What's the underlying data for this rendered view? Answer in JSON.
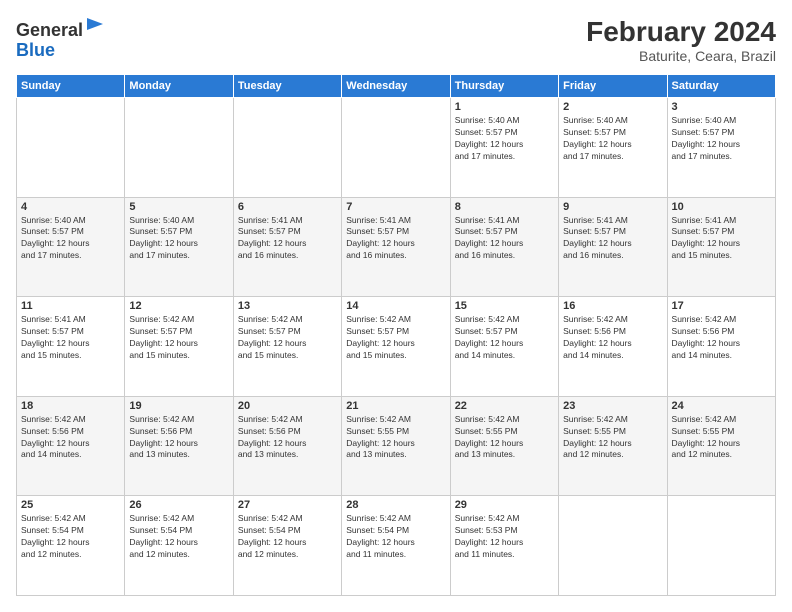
{
  "logo": {
    "general": "General",
    "blue": "Blue"
  },
  "header": {
    "month_title": "February 2024",
    "location": "Baturite, Ceara, Brazil"
  },
  "weekdays": [
    "Sunday",
    "Monday",
    "Tuesday",
    "Wednesday",
    "Thursday",
    "Friday",
    "Saturday"
  ],
  "weeks": [
    [
      {
        "day": "",
        "info": ""
      },
      {
        "day": "",
        "info": ""
      },
      {
        "day": "",
        "info": ""
      },
      {
        "day": "",
        "info": ""
      },
      {
        "day": "1",
        "info": "Sunrise: 5:40 AM\nSunset: 5:57 PM\nDaylight: 12 hours\nand 17 minutes."
      },
      {
        "day": "2",
        "info": "Sunrise: 5:40 AM\nSunset: 5:57 PM\nDaylight: 12 hours\nand 17 minutes."
      },
      {
        "day": "3",
        "info": "Sunrise: 5:40 AM\nSunset: 5:57 PM\nDaylight: 12 hours\nand 17 minutes."
      }
    ],
    [
      {
        "day": "4",
        "info": "Sunrise: 5:40 AM\nSunset: 5:57 PM\nDaylight: 12 hours\nand 17 minutes."
      },
      {
        "day": "5",
        "info": "Sunrise: 5:40 AM\nSunset: 5:57 PM\nDaylight: 12 hours\nand 17 minutes."
      },
      {
        "day": "6",
        "info": "Sunrise: 5:41 AM\nSunset: 5:57 PM\nDaylight: 12 hours\nand 16 minutes."
      },
      {
        "day": "7",
        "info": "Sunrise: 5:41 AM\nSunset: 5:57 PM\nDaylight: 12 hours\nand 16 minutes."
      },
      {
        "day": "8",
        "info": "Sunrise: 5:41 AM\nSunset: 5:57 PM\nDaylight: 12 hours\nand 16 minutes."
      },
      {
        "day": "9",
        "info": "Sunrise: 5:41 AM\nSunset: 5:57 PM\nDaylight: 12 hours\nand 16 minutes."
      },
      {
        "day": "10",
        "info": "Sunrise: 5:41 AM\nSunset: 5:57 PM\nDaylight: 12 hours\nand 15 minutes."
      }
    ],
    [
      {
        "day": "11",
        "info": "Sunrise: 5:41 AM\nSunset: 5:57 PM\nDaylight: 12 hours\nand 15 minutes."
      },
      {
        "day": "12",
        "info": "Sunrise: 5:42 AM\nSunset: 5:57 PM\nDaylight: 12 hours\nand 15 minutes."
      },
      {
        "day": "13",
        "info": "Sunrise: 5:42 AM\nSunset: 5:57 PM\nDaylight: 12 hours\nand 15 minutes."
      },
      {
        "day": "14",
        "info": "Sunrise: 5:42 AM\nSunset: 5:57 PM\nDaylight: 12 hours\nand 15 minutes."
      },
      {
        "day": "15",
        "info": "Sunrise: 5:42 AM\nSunset: 5:57 PM\nDaylight: 12 hours\nand 14 minutes."
      },
      {
        "day": "16",
        "info": "Sunrise: 5:42 AM\nSunset: 5:56 PM\nDaylight: 12 hours\nand 14 minutes."
      },
      {
        "day": "17",
        "info": "Sunrise: 5:42 AM\nSunset: 5:56 PM\nDaylight: 12 hours\nand 14 minutes."
      }
    ],
    [
      {
        "day": "18",
        "info": "Sunrise: 5:42 AM\nSunset: 5:56 PM\nDaylight: 12 hours\nand 14 minutes."
      },
      {
        "day": "19",
        "info": "Sunrise: 5:42 AM\nSunset: 5:56 PM\nDaylight: 12 hours\nand 13 minutes."
      },
      {
        "day": "20",
        "info": "Sunrise: 5:42 AM\nSunset: 5:56 PM\nDaylight: 12 hours\nand 13 minutes."
      },
      {
        "day": "21",
        "info": "Sunrise: 5:42 AM\nSunset: 5:55 PM\nDaylight: 12 hours\nand 13 minutes."
      },
      {
        "day": "22",
        "info": "Sunrise: 5:42 AM\nSunset: 5:55 PM\nDaylight: 12 hours\nand 13 minutes."
      },
      {
        "day": "23",
        "info": "Sunrise: 5:42 AM\nSunset: 5:55 PM\nDaylight: 12 hours\nand 12 minutes."
      },
      {
        "day": "24",
        "info": "Sunrise: 5:42 AM\nSunset: 5:55 PM\nDaylight: 12 hours\nand 12 minutes."
      }
    ],
    [
      {
        "day": "25",
        "info": "Sunrise: 5:42 AM\nSunset: 5:54 PM\nDaylight: 12 hours\nand 12 minutes."
      },
      {
        "day": "26",
        "info": "Sunrise: 5:42 AM\nSunset: 5:54 PM\nDaylight: 12 hours\nand 12 minutes."
      },
      {
        "day": "27",
        "info": "Sunrise: 5:42 AM\nSunset: 5:54 PM\nDaylight: 12 hours\nand 12 minutes."
      },
      {
        "day": "28",
        "info": "Sunrise: 5:42 AM\nSunset: 5:54 PM\nDaylight: 12 hours\nand 11 minutes."
      },
      {
        "day": "29",
        "info": "Sunrise: 5:42 AM\nSunset: 5:53 PM\nDaylight: 12 hours\nand 11 minutes."
      },
      {
        "day": "",
        "info": ""
      },
      {
        "day": "",
        "info": ""
      }
    ]
  ]
}
